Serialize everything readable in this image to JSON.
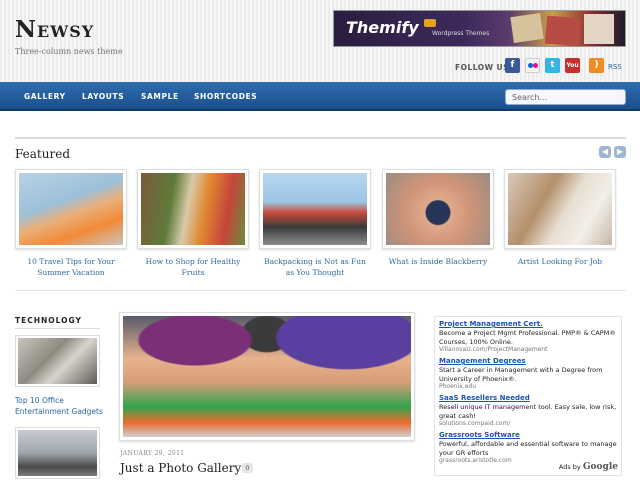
{
  "header": {
    "site_title": "Newsy",
    "tagline": "Three-column news theme",
    "banner": {
      "brand": "Themify",
      "tag": "Wordpress Themes"
    },
    "follow_label": "FOLLOW US",
    "rss_label": "RSS"
  },
  "nav": {
    "items": [
      "GALLERY",
      "LAYOUTS",
      "SAMPLE",
      "SHORTCODES"
    ],
    "search_placeholder": "Search..."
  },
  "featured": {
    "title": "Featured",
    "items": [
      {
        "caption": "10 Travel Tips for Your Summer Vacation"
      },
      {
        "caption": "How to Shop for Healthy Fruits"
      },
      {
        "caption": "Backpacking is Not as Fun as You Thought"
      },
      {
        "caption": "What is Inside Blackberry"
      },
      {
        "caption": "Artist Looking For Job"
      }
    ]
  },
  "technology": {
    "title": "TECHNOLOGY",
    "items": [
      {
        "label": "Top 10 Office Entertainment Gadgets"
      }
    ]
  },
  "main_post": {
    "date": "JANUARY 29, 2011",
    "title": "Just a Photo Gallery",
    "comments": "0"
  },
  "ads": {
    "items": [
      {
        "title": "Project Management Cert.",
        "desc": "Become a Project Mgmt Professional. PMP® & CAPM® Courses, 100% Online.",
        "url": "VillanovaU.com/ProjectManagement"
      },
      {
        "title": "Management Degrees",
        "desc": "Start a Career in Management with a Degree from University of Phoenix®.",
        "url": "Phoenix.edu"
      },
      {
        "title": "SaaS Resellers Needed",
        "desc": "Resell unique IT management tool. Easy sale, low risk, great cash!",
        "url": "solutions.compaid.com/"
      },
      {
        "title": "Grassroots Software",
        "desc": "Powerful, affordable and essential software to manage your GR efforts",
        "url": "grassroots.aristotle.com"
      }
    ],
    "ads_by": "Ads by",
    "ads_brand": "Google"
  }
}
